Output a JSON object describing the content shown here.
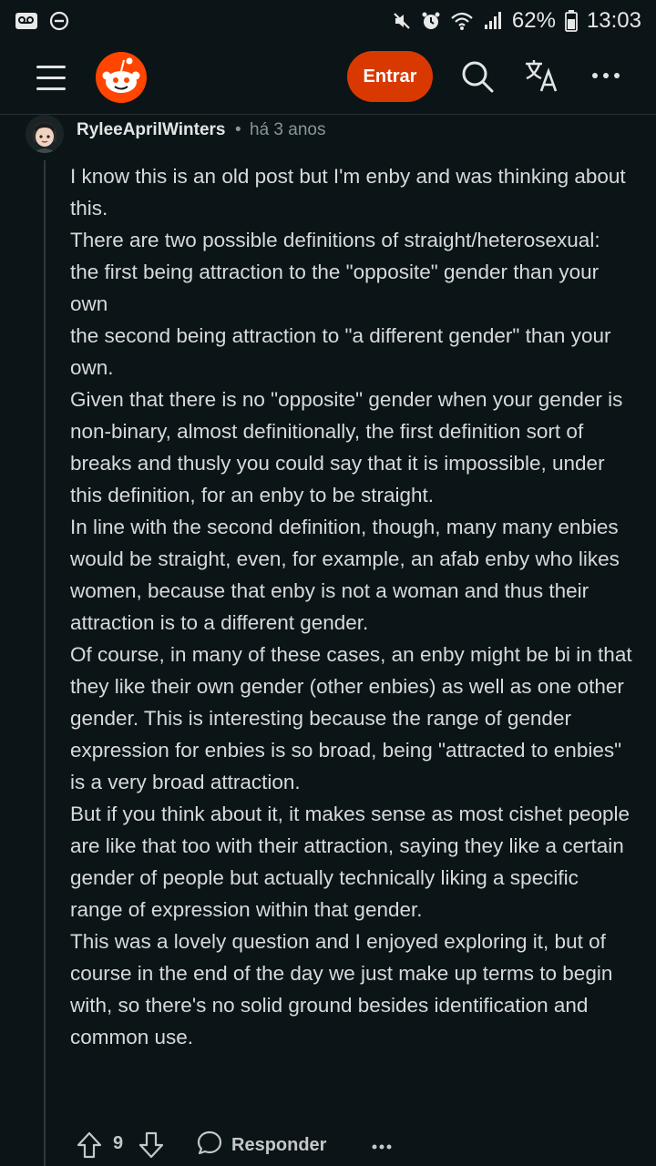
{
  "status_bar": {
    "battery": "62%",
    "time": "13:03",
    "icons": [
      "voicemail-icon",
      "dnd-circle-icon",
      "mute-icon",
      "alarm-icon",
      "wifi-icon",
      "signal-icon",
      "battery-icon"
    ]
  },
  "app_bar": {
    "login_label": "Entrar",
    "icons": [
      "menu-icon",
      "reddit-logo",
      "search-icon",
      "translate-icon",
      "more-icon"
    ]
  },
  "comment": {
    "username": "RyleeAprilWinters",
    "separator": "•",
    "timestamp": "há 3 anos",
    "paragraphs": [
      "I know this is an old post but I'm enby and was thinking about this.",
      "There are two possible definitions of straight/heterosexual:",
      "the first being attraction to the \"opposite\" gender than your own",
      "the second being attraction to \"a different gender\" than your own.",
      "Given that there is no \"opposite\" gender when your gender is non-binary, almost definitionally, the first definition sort of breaks and thusly you could say that it is impossible, under this definition, for an enby to be straight.",
      "In line with the second definition, though, many many enbies would be straight, even, for example, an afab enby who likes women, because that enby is not a woman and thus their attraction is to a different gender.",
      "Of course, in many of these cases, an enby might be bi in that they like their own gender (other enbies) as well as one other gender. This is interesting because the range of gender expression for enbies is so broad, being \"attracted to enbies\" is a very broad attraction.",
      "But if you think about it, it makes sense as most cishet people are like that too with their attraction, saying they like a certain gender of people but actually technically liking a specific range of expression within that gender.",
      "This was a lovely question and I enjoyed exploring it, but of course in the end of the day we just make up terms to begin with, so there's no solid ground besides identification and common use."
    ],
    "vote_count": "9",
    "reply_label": "Responder"
  },
  "colors": {
    "background": "#0b1416",
    "accent": "#d93900",
    "text": "#d7dadc",
    "muted": "#8a9599"
  }
}
